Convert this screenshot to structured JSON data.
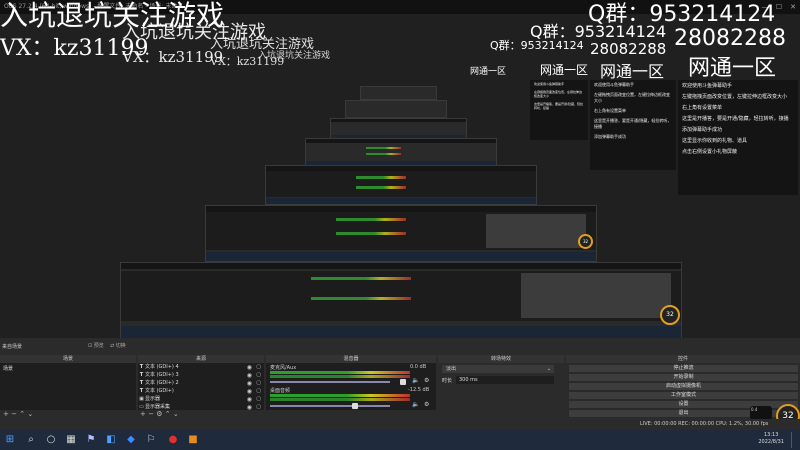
{
  "window": {
    "title": "OBS 27.2.4 (64-bit, windows) - 配置文件: 未命名 - 场景: 未命名"
  },
  "overlay": {
    "line1": "入坑退坑关注游戏",
    "line2": "VX：kz31199",
    "qq1": "Q群：953214124",
    "qq2": "28082288",
    "region": "网通一区",
    "chat_lines": [
      "欢迎使用斗鱼弹幕助手",
      "左键拖拽页面改变位置，左键拉伸边框改变大小",
      "右上角有设置菜单",
      "这里是开播答，要是开通/隐藏，轻拉转听，接播",
      "添加弹幕助手成功",
      "这里显示你收到的礼物、道具",
      "点击右侧设置小礼物屏蔽"
    ]
  },
  "scenes": {
    "header": "来自场景",
    "panel_title": "场景",
    "item": "场景",
    "btn_a": "预览",
    "btn_b": "切换"
  },
  "sources": {
    "panel_title": "来源",
    "items": [
      {
        "icon": "T",
        "label": "文本 (GDI+) 4"
      },
      {
        "icon": "T",
        "label": "文本 (GDI+) 3"
      },
      {
        "icon": "T",
        "label": "文本 (GDI+) 2"
      },
      {
        "icon": "T",
        "label": "文本 (GDI+)"
      },
      {
        "icon": "▣",
        "label": "显示器"
      },
      {
        "icon": "▭",
        "label": "显示器采集"
      }
    ]
  },
  "mixer": {
    "panel_title": "混音器",
    "ch1_name": "麦克风/Aux",
    "ch1_db": "0.0 dB",
    "ch2_name": "桌面音频",
    "ch2_db": "-12.5 dB"
  },
  "transitions": {
    "panel_title": "转场特效",
    "type": "淡出",
    "duration_label": "时长",
    "duration_value": "300 ms"
  },
  "controls": {
    "panel_title": "控件",
    "buttons": [
      "停止推流",
      "开始录制",
      "启动虚拟摄像机",
      "工作室模式",
      "设置",
      "退出"
    ]
  },
  "status": {
    "text": "LIVE: 00:00:00   REC: 00:00:00   CPU: 1.2%, 30.00 fps"
  },
  "taskbar": {
    "time": "13:13",
    "date": "2022/8/31"
  },
  "fps_badge": "32",
  "fps_badge_small": "0.4",
  "colors": {
    "accent_ring": "#e0a020",
    "meter_green": "#2e9e2e",
    "meter_yellow": "#cbcb1e",
    "meter_red": "#c03030",
    "background": "#202020"
  }
}
